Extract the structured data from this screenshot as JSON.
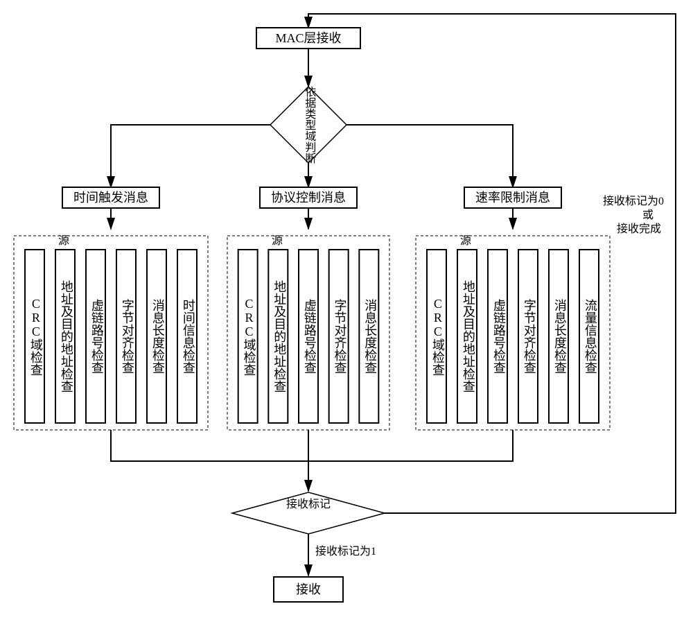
{
  "top_box": "MAC层接收",
  "type_decision": "依据类型域判断",
  "branch_left": "时间触发消息",
  "branch_mid": "协议控制消息",
  "branch_right": "速率限制消息",
  "right_note_line1": "接收标记为0",
  "right_note_line2": "或",
  "right_note_line3": "接收完成",
  "dashed_label": "源",
  "checks_left": [
    "CRC域检查",
    "地址及目的地址检查",
    "虚链路号检查",
    "字节对齐检查",
    "消息长度检查",
    "时间信息检查"
  ],
  "checks_mid": [
    "CRC域检查",
    "地址及目的地址检查",
    "虚链路号检查",
    "字节对齐检查",
    "消息长度检查"
  ],
  "checks_right": [
    "CRC域检查",
    "地址及目的地址检查",
    "虚链路号检查",
    "字节对齐检查",
    "消息长度检查",
    "流量信息检查"
  ],
  "recv_mark": "接收标记",
  "recv_mark_1": "接收标记为1",
  "recv_box": "接收",
  "chart_data": {
    "type": "flowchart",
    "nodes": [
      {
        "id": "mac",
        "kind": "process",
        "label": "MAC层接收"
      },
      {
        "id": "type_decision",
        "kind": "decision",
        "label": "依据类型域判断"
      },
      {
        "id": "br_time",
        "kind": "process",
        "label": "时间触发消息"
      },
      {
        "id": "br_proto",
        "kind": "process",
        "label": "协议控制消息"
      },
      {
        "id": "br_rate",
        "kind": "process",
        "label": "速率限制消息"
      },
      {
        "id": "grp_time",
        "kind": "group",
        "label": "源",
        "children": [
          "CRC域检查",
          "地址及目的地址检查",
          "虚链路号检查",
          "字节对齐检查",
          "消息长度检查",
          "时间信息检查"
        ]
      },
      {
        "id": "grp_proto",
        "kind": "group",
        "label": "源",
        "children": [
          "CRC域检查",
          "地址及目的地址检查",
          "虚链路号检查",
          "字节对齐检查",
          "消息长度检查"
        ]
      },
      {
        "id": "grp_rate",
        "kind": "group",
        "label": "源",
        "children": [
          "CRC域检查",
          "地址及目的地址检查",
          "虚链路号检查",
          "字节对齐检查",
          "消息长度检查",
          "流量信息检查"
        ]
      },
      {
        "id": "recv_mark",
        "kind": "decision",
        "label": "接收标记"
      },
      {
        "id": "recv",
        "kind": "process",
        "label": "接收"
      }
    ],
    "edges": [
      {
        "from": "mac",
        "to": "type_decision"
      },
      {
        "from": "type_decision",
        "to": "br_time"
      },
      {
        "from": "type_decision",
        "to": "br_proto"
      },
      {
        "from": "type_decision",
        "to": "br_rate"
      },
      {
        "from": "br_time",
        "to": "grp_time"
      },
      {
        "from": "br_proto",
        "to": "grp_proto"
      },
      {
        "from": "br_rate",
        "to": "grp_rate"
      },
      {
        "from": "grp_time",
        "to": "recv_mark"
      },
      {
        "from": "grp_proto",
        "to": "recv_mark"
      },
      {
        "from": "grp_rate",
        "to": "recv_mark"
      },
      {
        "from": "recv_mark",
        "to": "recv",
        "label": "接收标记为1"
      },
      {
        "from": "recv_mark",
        "to": "mac",
        "label": "接收标记为0 或 接收完成"
      }
    ]
  }
}
